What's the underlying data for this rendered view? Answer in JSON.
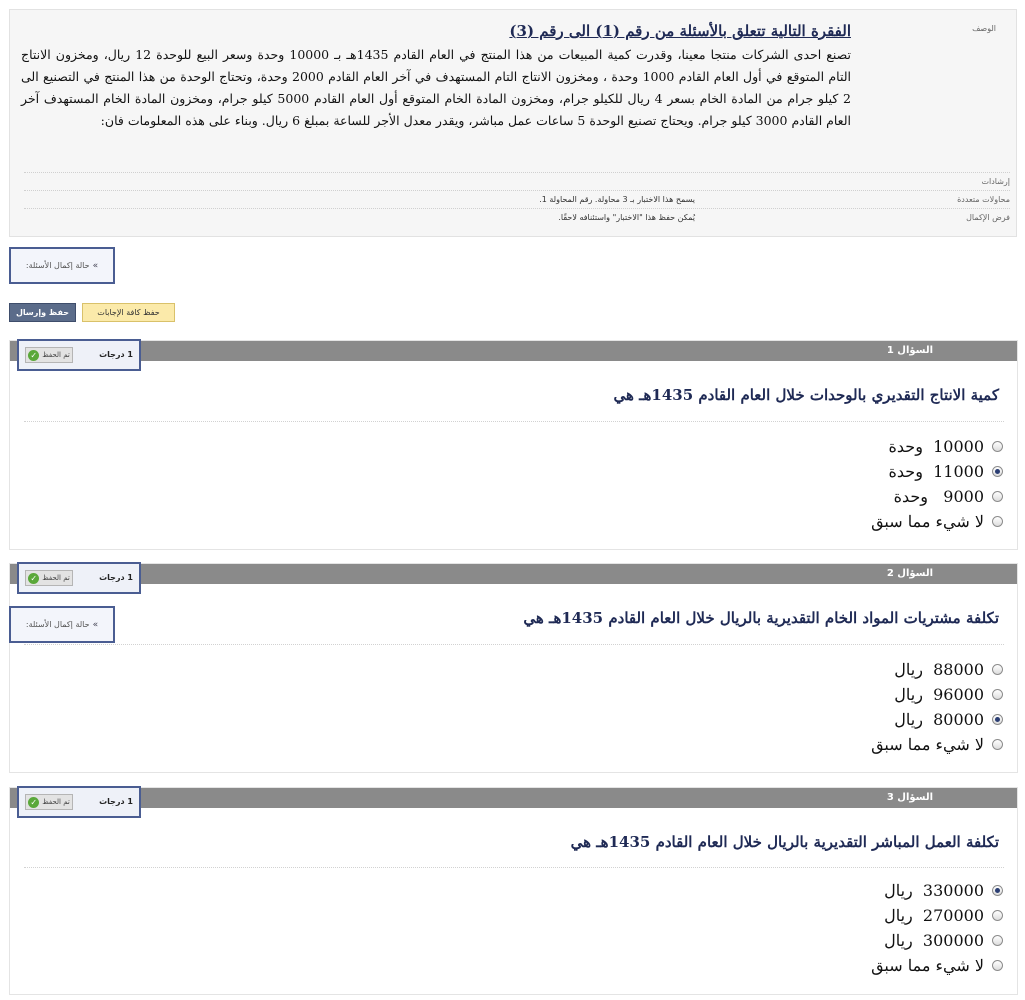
{
  "description": {
    "label": "الوصف",
    "title": "الفقرة التالية تتعلق بالأسئلة من رقم (1) الى رقم (3)",
    "text": "تصنع احدى الشركات منتجا معينا، وقدرت كمية المبيعات من هذا المنتج في العام القادم 1435هـ بـ 10000 وحدة وسعر البيع للوحدة 12 ريال، ومخزون الانتاج التام المتوقع في أول العام القادم 1000 وحدة ، ومخزون الانتاج التام المستهدف في آخر العام القادم 2000 وحدة، وتحتاج الوحدة من هذا المنتج في التصنيع الى 2 كيلو جرام من المادة الخام بسعر 4 ريال للكيلو جرام، ومخزون المادة الخام المتوقع أول العام القادم 5000 كيلو جرام، ومخزون المادة الخام المستهدف آخر العام القادم 3000 كيلو جرام. ويحتاج تصنيع الوحدة 5 ساعات عمل مباشر، ويقدر معدل الأجر للساعة بمبلغ 6 ريال. وبناء على هذه المعلومات فان:"
  },
  "info_rows": [
    {
      "label": "إرشادات",
      "value": ""
    },
    {
      "label": "محاولات متعددة",
      "value": "يسمح هذا الاختبار بـ 3 محاولة. رقم المحاولة 1."
    },
    {
      "label": "فرض الإكمال",
      "value": "يُمكن حفظ هذا \"الاختبار\" واستئنافه لاحقًا."
    }
  ],
  "completion_status": {
    "label": "حالة إكمال الأسئلة:"
  },
  "buttons": {
    "save_all": "حفظ كافة الإجابات",
    "save_submit": "حفظ وإرسال"
  },
  "questions": [
    {
      "number_label": "السؤال 1",
      "points": "1 درجات",
      "saved_label": "تم الحفظ",
      "text": "كمية الانتاج التقديري بالوحدات خلال العام القادم 1435هـ هي",
      "options": [
        {
          "label": "10000  وحدة",
          "selected": false
        },
        {
          "label": "11000  وحدة",
          "selected": true
        },
        {
          "label": "9000   وحدة",
          "selected": false
        },
        {
          "label": "لا شيء مما سبق",
          "selected": false
        }
      ]
    },
    {
      "number_label": "السؤال 2",
      "points": "1 درجات",
      "saved_label": "تم الحفظ",
      "text": "تكلفة مشتريات المواد الخام التقديرية بالريال خلال العام القادم 1435هـ هي",
      "options": [
        {
          "label": "88000  ريال",
          "selected": false
        },
        {
          "label": "96000  ريال",
          "selected": false
        },
        {
          "label": "80000  ريال",
          "selected": true
        },
        {
          "label": "لا شيء مما سبق",
          "selected": false
        }
      ]
    },
    {
      "number_label": "السؤال 3",
      "points": "1 درجات",
      "saved_label": "تم الحفظ",
      "text": "تكلفة العمل المباشر التقديرية بالريال خلال العام القادم 1435هـ هي",
      "options": [
        {
          "label": "330000  ريال",
          "selected": true
        },
        {
          "label": "270000  ريال",
          "selected": false
        },
        {
          "label": "300000  ريال",
          "selected": false
        },
        {
          "label": "لا شيء مما سبق",
          "selected": false
        }
      ]
    }
  ]
}
